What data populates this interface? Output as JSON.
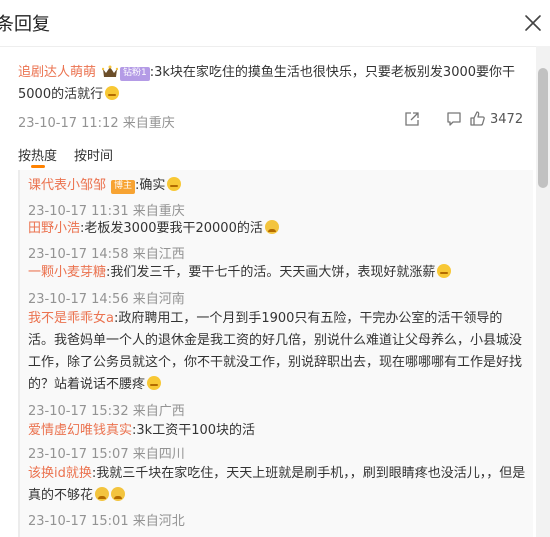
{
  "header": {
    "title": "条回复"
  },
  "main_comment": {
    "user": "追剧达人萌萌",
    "badge": "钻粉1",
    "text": ":3k块在家吃住的摸鱼生活也很快乐，只要老板别发3000要你干5000的活就行",
    "meta": "23-10-17 11:12 来自重庆",
    "like_count": "3472"
  },
  "sort": {
    "hot": "按热度",
    "time": "按时间"
  },
  "replies": [
    {
      "user": "课代表小邹邹",
      "badge": "博主",
      "text": ":确实",
      "meta": "23-10-17 11:31 来自重庆"
    },
    {
      "user": "田野小浩",
      "text": ":老板发3000要我干20000的活",
      "meta": "23-10-17 14:58 来自江西"
    },
    {
      "user": "一颗小麦芽糖",
      "text": ":我们发三千，要干七千的活。天天画大饼，表现好就涨薪",
      "meta": "23-10-17 14:56 来自河南"
    },
    {
      "user": "我不是乖乖女a",
      "text": ":政府聘用工，一个月到手1900只有五险，干完办公室的活干领导的活。我爸妈单一个人的退休金是我工资的好几倍，别说什么难道让父母养么，小县城没工作，除了公务员就这个，你不干就没工作，别说辞职出去，现在哪哪哪有工作是好找的？站着说话不腰疼",
      "meta": "23-10-17 15:32 来自广西"
    },
    {
      "user": "爱情虚幻唯钱真实",
      "text": ":3k工资干100块的活",
      "meta": "23-10-17 15:07 来自四川"
    },
    {
      "user": "该换id就换",
      "text": ":我就三千块在家吃住，天天上班就是刷手机，，刷到眼睛疼也没活儿，，但是真的不够花",
      "meta": "23-10-17 15:01 来自河北"
    }
  ]
}
